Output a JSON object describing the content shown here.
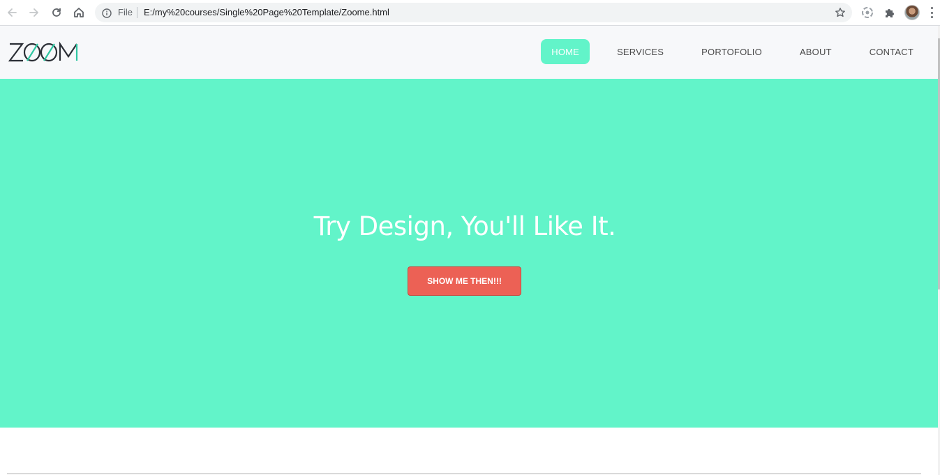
{
  "browser": {
    "scheme_label": "File",
    "url": "E:/my%20courses/Single%20Page%20Template/Zoome.html",
    "icons": [
      "back-icon",
      "forward-icon",
      "reload-icon",
      "home-icon",
      "info-icon",
      "bookmark-star-icon",
      "extension-icon",
      "puzzle-icon",
      "avatar",
      "menu-icon"
    ]
  },
  "site": {
    "logo_text": "ZOOM",
    "nav": [
      {
        "label": "HOME",
        "active": true
      },
      {
        "label": "SERVICES",
        "active": false
      },
      {
        "label": "PORTOFOLIO",
        "active": false
      },
      {
        "label": "ABOUT",
        "active": false
      },
      {
        "label": "CONTACT",
        "active": false
      }
    ],
    "hero": {
      "title": "Try Design, You'll Like It.",
      "button_label": "SHOW ME THEN!!!"
    }
  },
  "colors": {
    "accent": "#62f4c9",
    "header_bg": "#f7f8fa",
    "button": "#ec6155",
    "logo_dark": "#2b2f36",
    "logo_accent": "#2fc6a1"
  }
}
